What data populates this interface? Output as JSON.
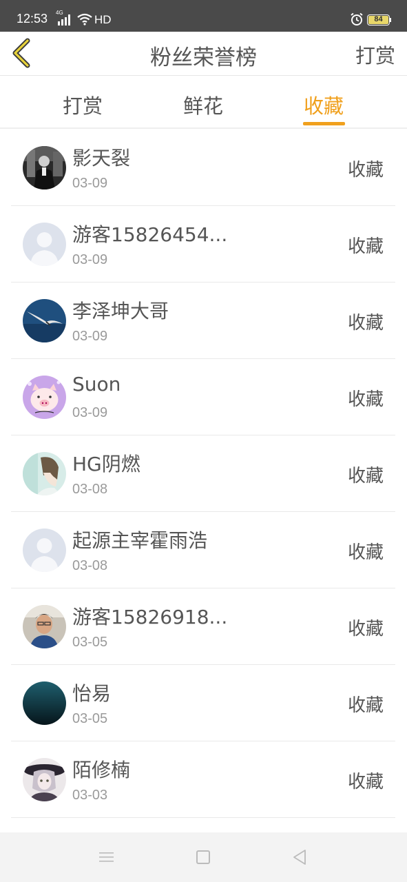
{
  "status_bar": {
    "time": "12:53",
    "network": "4G",
    "hd": "HD",
    "battery": "84"
  },
  "header": {
    "title": "粉丝荣誉榜",
    "action": "打赏"
  },
  "tabs": [
    {
      "label": "打赏",
      "active": false
    },
    {
      "label": "鲜花",
      "active": false
    },
    {
      "label": "收藏",
      "active": true
    }
  ],
  "items": [
    {
      "name": "影天裂",
      "date": "03-09",
      "action": "收藏",
      "avatar": "photo-man-avatar"
    },
    {
      "name": "游客15826454...",
      "date": "03-09",
      "action": "收藏",
      "avatar": "default-avatar"
    },
    {
      "name": "李泽坤大哥",
      "date": "03-09",
      "action": "收藏",
      "avatar": "seagull-avatar"
    },
    {
      "name": "Suon",
      "date": "03-09",
      "action": "收藏",
      "avatar": "pig-cartoon-avatar"
    },
    {
      "name": "HG阴燃",
      "date": "03-08",
      "action": "收藏",
      "avatar": "anime-boy-avatar"
    },
    {
      "name": "起源主宰霍雨浩",
      "date": "03-08",
      "action": "收藏",
      "avatar": "default-avatar"
    },
    {
      "name": "游客15826918...",
      "date": "03-05",
      "action": "收藏",
      "avatar": "photo-person-avatar"
    },
    {
      "name": "怡易",
      "date": "03-05",
      "action": "收藏",
      "avatar": "dark-teal-avatar"
    },
    {
      "name": "陌修楠",
      "date": "03-03",
      "action": "收藏",
      "avatar": "anime-girl-avatar"
    }
  ],
  "colors": {
    "accent": "#f0a01d",
    "status_bar": "#4a4a4a",
    "text": "#555555",
    "subtext": "#9a9a9a"
  }
}
